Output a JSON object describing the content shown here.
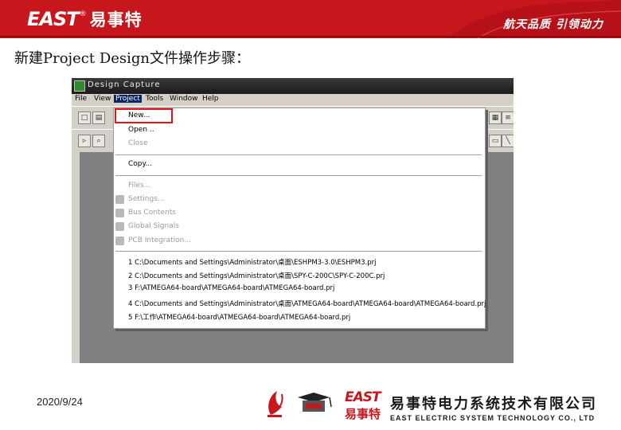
{
  "banner": {
    "brand_en": "EAST",
    "brand_reg": "®",
    "brand_cn": "易事特",
    "slogan": "航天品质 引领动力",
    "color": "#c8161d"
  },
  "heading": "新建Project Design文件操作步骤：",
  "window": {
    "title": "Design Capture",
    "menus": [
      "File",
      "View",
      "Project",
      "Tools",
      "Window",
      "Help"
    ],
    "active_menu": "Project",
    "dropdown": {
      "new": "New...",
      "open": "Open ..",
      "close": "Close",
      "copy": "Copy...",
      "files": "Files...",
      "settings": "Settings...",
      "bus_contents": "Bus Contents",
      "global_signals": "Global Signals",
      "pcb_integration": "PCB Integration...",
      "recent": [
        "1 C:\\Documents and Settings\\Administrator\\桌面\\ESHPM3-3.0\\ESHPM3.prj",
        "2 C:\\Documents and Settings\\Administrator\\桌面\\SPY-C-200C\\SPY-C-200C.prj",
        "3 F:\\ATMEGA64-board\\ATMEGA64-board\\ATMEGA64-board.prj",
        "4 C:\\Documents and Settings\\Administrator\\桌面\\ATMEGA64-board\\ATMEGA64-board\\ATMEGA64-board.prj",
        "5 F:\\工作\\ATMEGA64-board\\ATMEGA64-board\\ATMEGA64-board.prj"
      ]
    }
  },
  "footer": {
    "date": "2020/9/24",
    "east_en": "EAST",
    "east_cn": "易事特",
    "company_cn": "易事特电力系统技术有限公司",
    "company_en": "EAST ELECTRIC SYSTEM TECHNOLOGY CO., LTD"
  }
}
